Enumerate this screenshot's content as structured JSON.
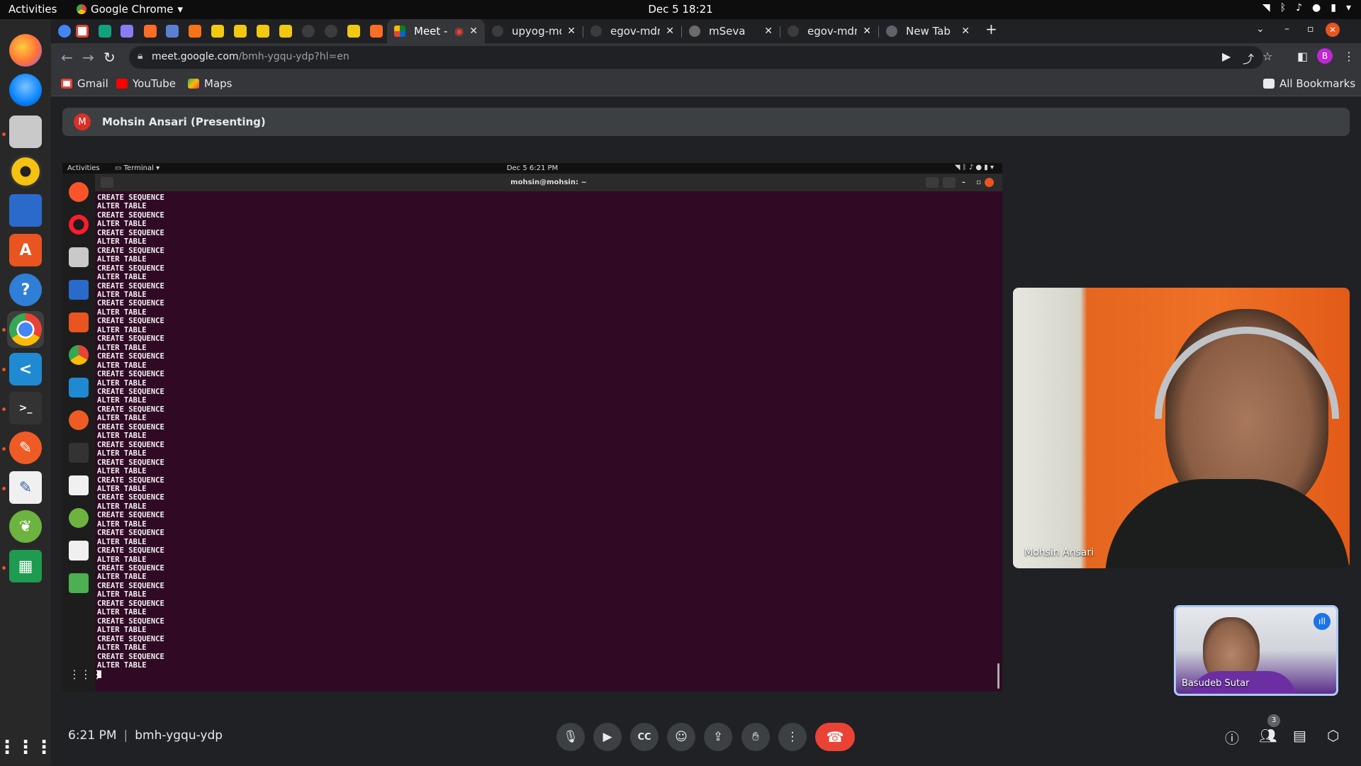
{
  "system_bar": {
    "activities": "Activities",
    "app_menu": "Google Chrome",
    "clock": "Dec 5  18:21"
  },
  "chrome": {
    "tabs": [
      {
        "title": "Meet - bmh",
        "active": true
      },
      {
        "title": "upyog-mdms-d"
      },
      {
        "title": "egov-mdms-da"
      },
      {
        "title": "mSeva"
      },
      {
        "title": "egov-mdms-da"
      },
      {
        "title": "New Tab"
      }
    ],
    "url_host": "meet.google.com",
    "url_path": "/bmh-ygqu-ydp?hl=en",
    "profile_initial": "B",
    "bookmarks": [
      "Gmail",
      "YouTube",
      "Maps"
    ],
    "all_bookmarks": "All Bookmarks"
  },
  "meet": {
    "presenter": {
      "initial": "M",
      "label": "Mohsin Ansari (Presenting)"
    },
    "shared_screen": {
      "activities": "Activities",
      "app": "Terminal",
      "clock": "Dec 5  6:21 PM",
      "window_title": "mohsin@mohsin: ~",
      "terminal_output": "CREATE SEQUENCE\nALTER TABLE\nCREATE SEQUENCE\nALTER TABLE\nCREATE SEQUENCE\nALTER TABLE\nCREATE SEQUENCE\nALTER TABLE\nCREATE SEQUENCE\nALTER TABLE\nCREATE SEQUENCE\nALTER TABLE\nCREATE SEQUENCE\nALTER TABLE\nCREATE SEQUENCE\nALTER TABLE\nCREATE SEQUENCE\nALTER TABLE\nCREATE SEQUENCE\nALTER TABLE\nCREATE SEQUENCE\nALTER TABLE\nCREATE SEQUENCE\nALTER TABLE\nCREATE SEQUENCE\nALTER TABLE\nCREATE SEQUENCE\nALTER TABLE\nCREATE SEQUENCE\nALTER TABLE\nCREATE SEQUENCE\nALTER TABLE\nCREATE SEQUENCE\nALTER TABLE\nCREATE SEQUENCE\nALTER TABLE\nCREATE SEQUENCE\nALTER TABLE\nCREATE SEQUENCE\nALTER TABLE\nCREATE SEQUENCE\nALTER TABLE\nCREATE SEQUENCE\nALTER TABLE\nCREATE SEQUENCE\nALTER TABLE\nCREATE SEQUENCE\nALTER TABLE\nCREATE SEQUENCE\nALTER TABLE\nCREATE SEQUENCE\nALTER TABLE\nCREATE SEQUENCE\nALTER TABLE"
    },
    "participants": [
      {
        "name": "Mohsin Ansari"
      },
      {
        "name": "Basudeb Sutar"
      }
    ],
    "time": "6:21 PM",
    "separator": "|",
    "meeting_code": "bmh-ygqu-ydp",
    "people_count": "3"
  }
}
